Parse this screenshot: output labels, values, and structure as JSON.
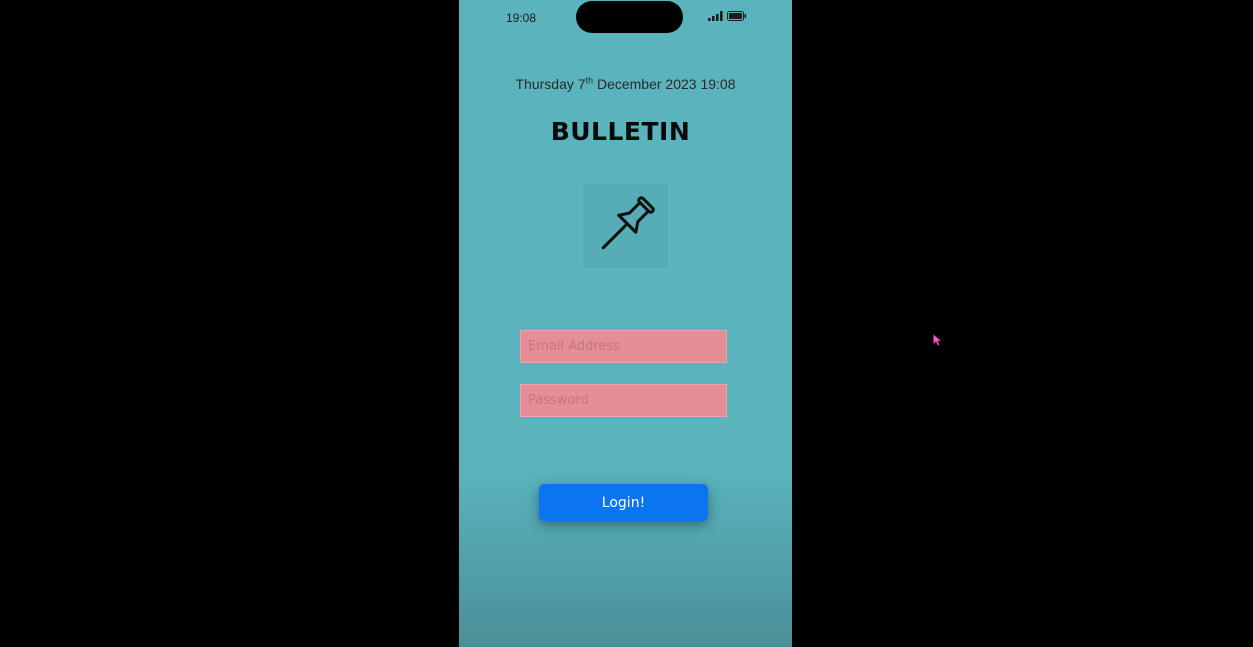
{
  "status_bar": {
    "time": "19:08",
    "icons": [
      "signal-icon",
      "battery-icon"
    ]
  },
  "header": {
    "date_prefix": "Thursday 7",
    "date_suffix": "th",
    "date_rest": " December 2023 19:08",
    "title": "BULLETIN"
  },
  "logo": {
    "icon": "pushpin-icon"
  },
  "form": {
    "email_placeholder": "Email Address",
    "email_value": "",
    "password_placeholder": "Password",
    "password_value": "",
    "login_label": "Login!"
  },
  "colors": {
    "background": "#5bb4bd",
    "field_fill": "#e68e98",
    "button": "#0b74f0",
    "outside": "#000000",
    "cursor": "#ff5ad8"
  }
}
